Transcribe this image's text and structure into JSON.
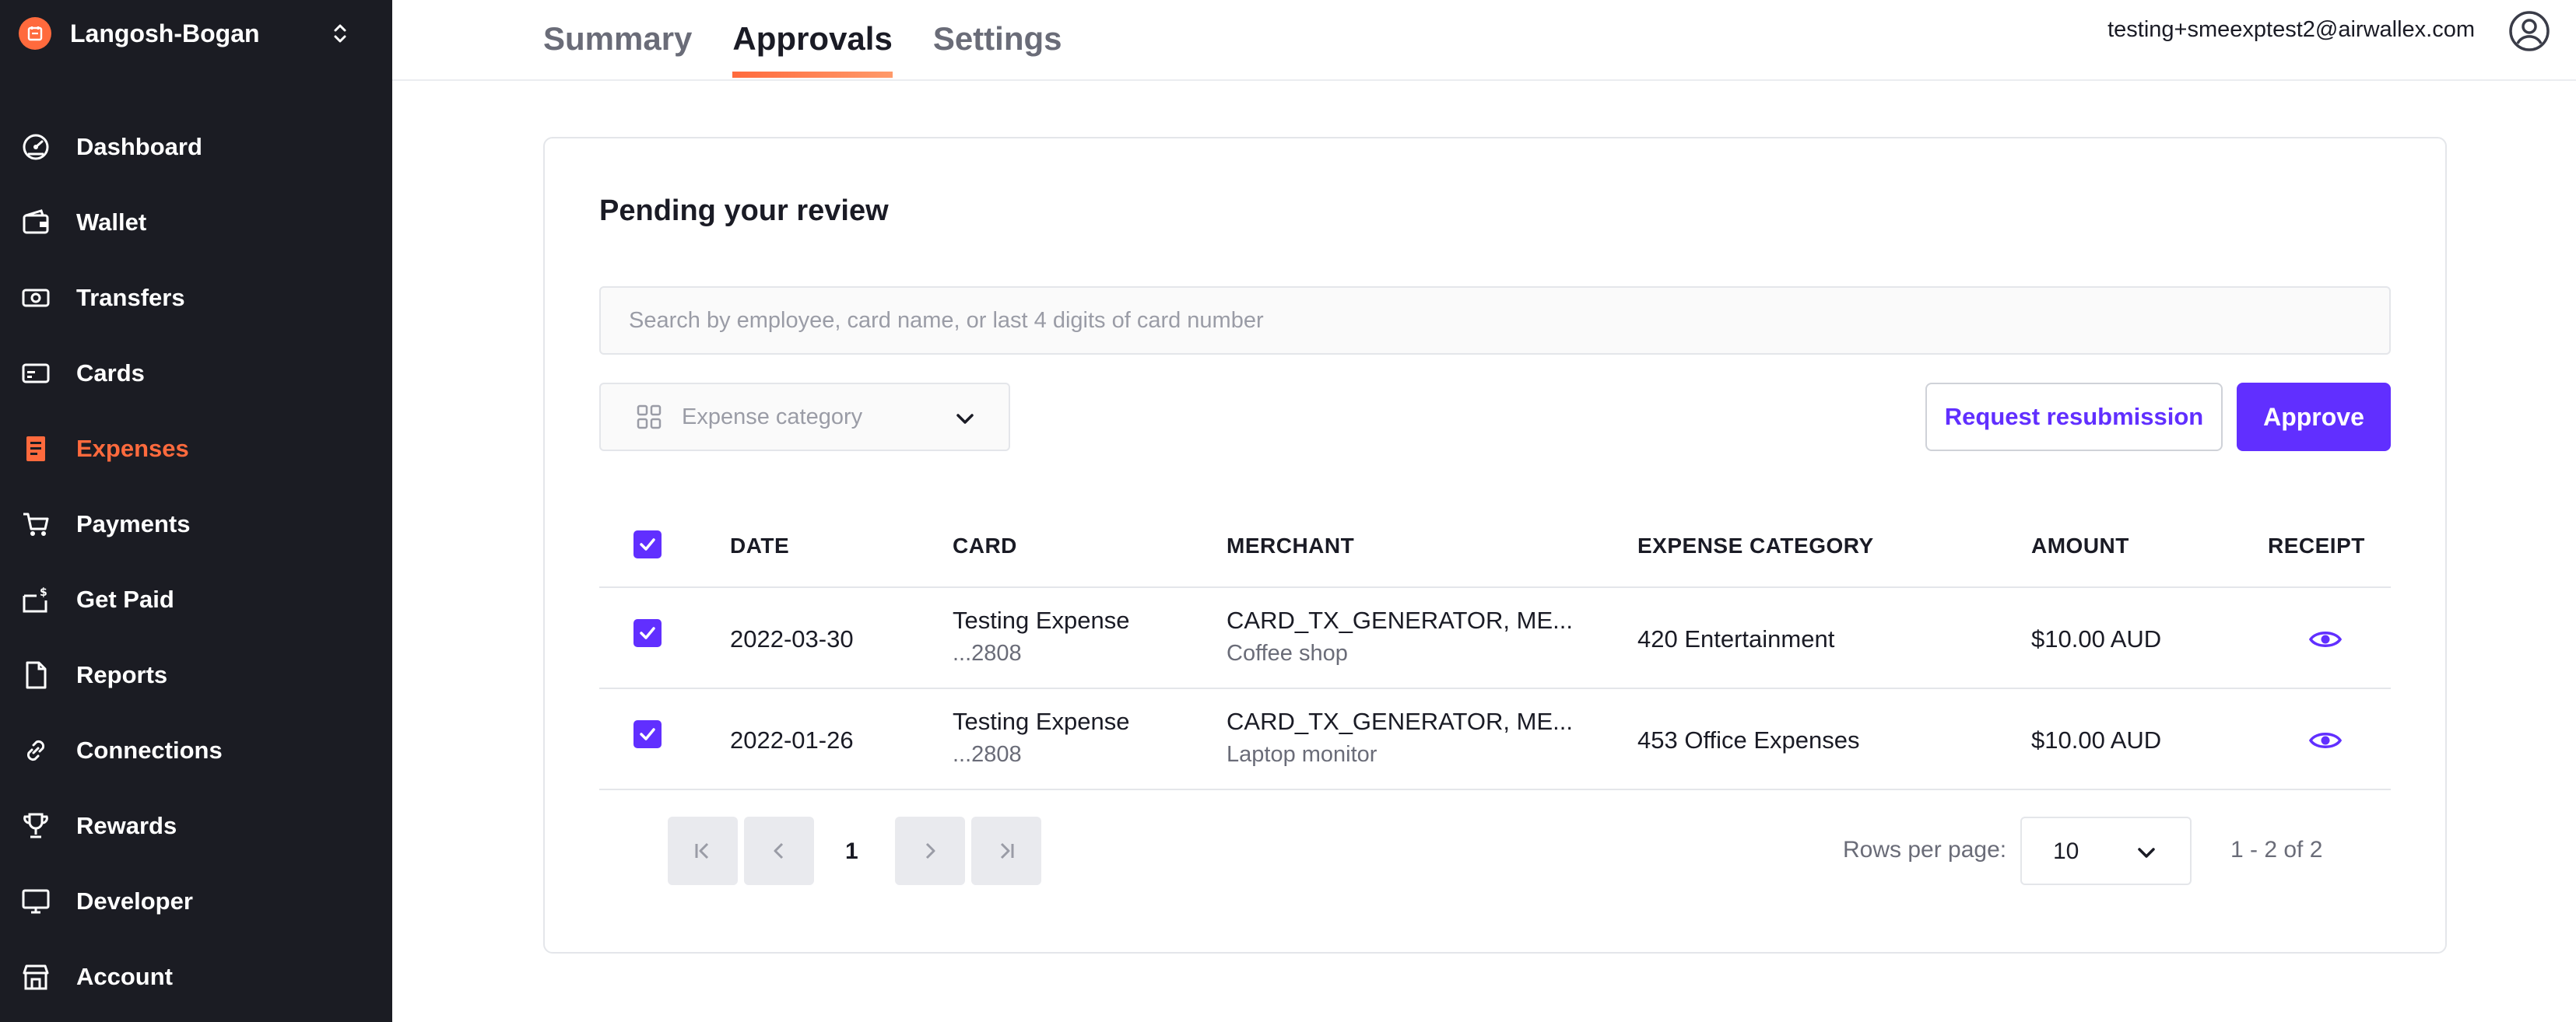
{
  "sidebar": {
    "org_name": "Langosh-Bogan",
    "items": [
      {
        "label": "Dashboard",
        "icon": "dashboard-gauge-icon"
      },
      {
        "label": "Wallet",
        "icon": "wallet-icon"
      },
      {
        "label": "Transfers",
        "icon": "transfers-banknote-icon"
      },
      {
        "label": "Cards",
        "icon": "card-icon"
      },
      {
        "label": "Expenses",
        "icon": "receipt-icon",
        "active": true
      },
      {
        "label": "Payments",
        "icon": "cart-icon"
      },
      {
        "label": "Get Paid",
        "icon": "get-paid-icon"
      },
      {
        "label": "Reports",
        "icon": "document-icon"
      },
      {
        "label": "Connections",
        "icon": "link-icon"
      },
      {
        "label": "Rewards",
        "icon": "trophy-icon"
      },
      {
        "label": "Developer",
        "icon": "monitor-icon"
      },
      {
        "label": "Account",
        "icon": "store-icon"
      }
    ]
  },
  "header": {
    "tabs": [
      {
        "label": "Summary"
      },
      {
        "label": "Approvals",
        "active": true
      },
      {
        "label": "Settings"
      }
    ],
    "user_email": "testing+smeexptest2@airwallex.com"
  },
  "review": {
    "title": "Pending your review",
    "search_placeholder": "Search by employee, card name, or last 4 digits of card number",
    "category_placeholder": "Expense category",
    "request_resubmission_label": "Request resubmission",
    "approve_label": "Approve",
    "columns": {
      "date": "DATE",
      "card": "CARD",
      "merchant": "MERCHANT",
      "category": "EXPENSE CATEGORY",
      "amount": "AMOUNT",
      "receipt": "RECEIPT"
    },
    "rows": [
      {
        "checked": true,
        "date": "2022-03-30",
        "card_name": "Testing Expense",
        "card_last4": "...2808",
        "merchant": "CARD_TX_GENERATOR, ME...",
        "merchant_note": "Coffee shop",
        "category": "420 Entertainment",
        "amount": "$10.00 AUD"
      },
      {
        "checked": true,
        "date": "2022-01-26",
        "card_name": "Testing Expense",
        "card_last4": "...2808",
        "merchant": "CARD_TX_GENERATOR, ME...",
        "merchant_note": "Laptop monitor",
        "category": "453 Office Expenses",
        "amount": "$10.00 AUD"
      }
    ],
    "pagination": {
      "current_page": "1",
      "rows_per_page_label": "Rows per page:",
      "rows_per_page": "10",
      "range": "1 - 2 of 2"
    }
  },
  "colors": {
    "accent": "#612fff",
    "brand_orange": "#ff6a3d",
    "sidebar_bg": "#1b1c23"
  }
}
